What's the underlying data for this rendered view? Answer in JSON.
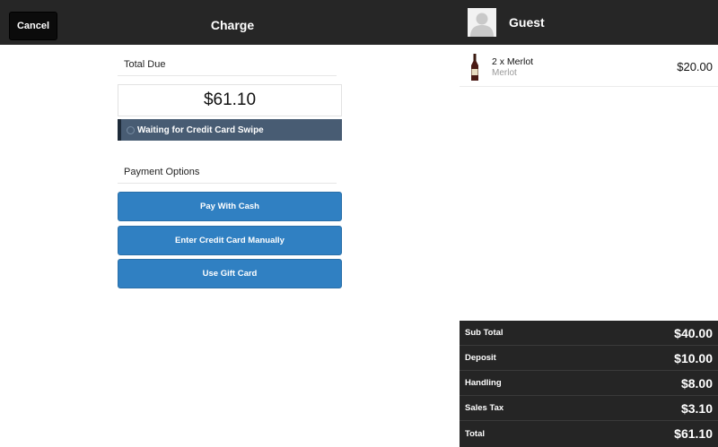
{
  "header": {
    "cancel_label": "Cancel",
    "title": "Charge"
  },
  "charge": {
    "total_due_label": "Total Due",
    "total_due_value": "$61.10",
    "status_text": "Waiting for Credit Card Swipe",
    "payment_options_label": "Payment Options",
    "options": [
      "Pay With Cash",
      "Enter Credit Card Manually",
      "Use Gift Card"
    ]
  },
  "customer": {
    "name": "Guest",
    "avatar_icon": "user-placeholder-icon"
  },
  "cart": {
    "items": [
      {
        "name": "2 x Merlot",
        "subtitle": "Merlot",
        "price": "$20.00",
        "icon": "wine-bottle-icon"
      }
    ]
  },
  "totals": [
    {
      "label": "Sub Total",
      "value": "$40.00"
    },
    {
      "label": "Deposit",
      "value": "$10.00"
    },
    {
      "label": "Handling",
      "value": "$8.00"
    },
    {
      "label": "Sales Tax",
      "value": "$3.10"
    },
    {
      "label": "Total",
      "value": "$61.10"
    }
  ],
  "colors": {
    "header_bg": "#262626",
    "button_blue": "#3080c2",
    "status_bar": "#485c73",
    "totals_bg": "#252525"
  }
}
